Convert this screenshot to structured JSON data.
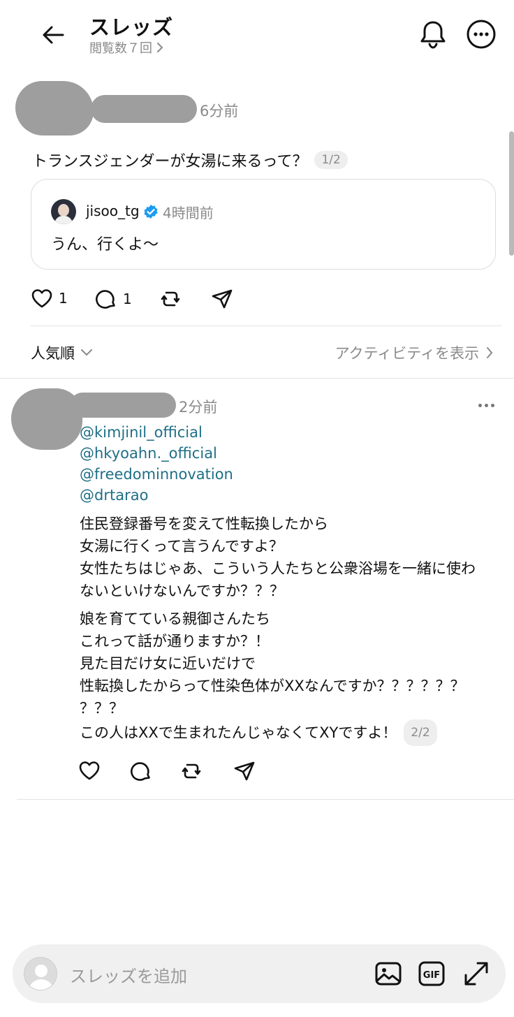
{
  "header": {
    "title": "スレッズ",
    "views": "閲覧数７回"
  },
  "post": {
    "time": "6分前",
    "text": "トランスジェンダーが女湯に来るって？",
    "page_indicator": "1/2",
    "quote": {
      "username": "jisoo_tg",
      "time": "4時間前",
      "text": "うん、行くよ〜"
    },
    "likes": "1",
    "replies": "1"
  },
  "sort": {
    "label": "人気順",
    "activity_link": "アクティビティを表示"
  },
  "reply": {
    "time": "2分前",
    "mentions": [
      "@kimjinil_official",
      "@hkyoahn._official",
      "@freedominnovation",
      "@drtarao"
    ],
    "paragraph1": [
      "住民登録番号を変えて性転換したから",
      "女湯に行くって言うんですよ？",
      "女性たちはじゃあ、こういう人たちと公衆浴場を一緒に使わ",
      "ないといけないんですか？？？"
    ],
    "paragraph2": [
      "娘を育てている親御さんたち",
      "これって話が通りますか？！",
      "見た目だけ女に近いだけで",
      "性転換したからって性染色体がXXなんですか？？？？？？",
      "？？？"
    ],
    "last_line": "この人はXXで生まれたんじゃなくてXYですよ！",
    "page_indicator": "2/2"
  },
  "composer": {
    "placeholder": "スレッズを追加"
  },
  "colors": {
    "mention": "#1f6f86",
    "verified": "#1d9bf0",
    "muted": "#8a8a8a"
  }
}
